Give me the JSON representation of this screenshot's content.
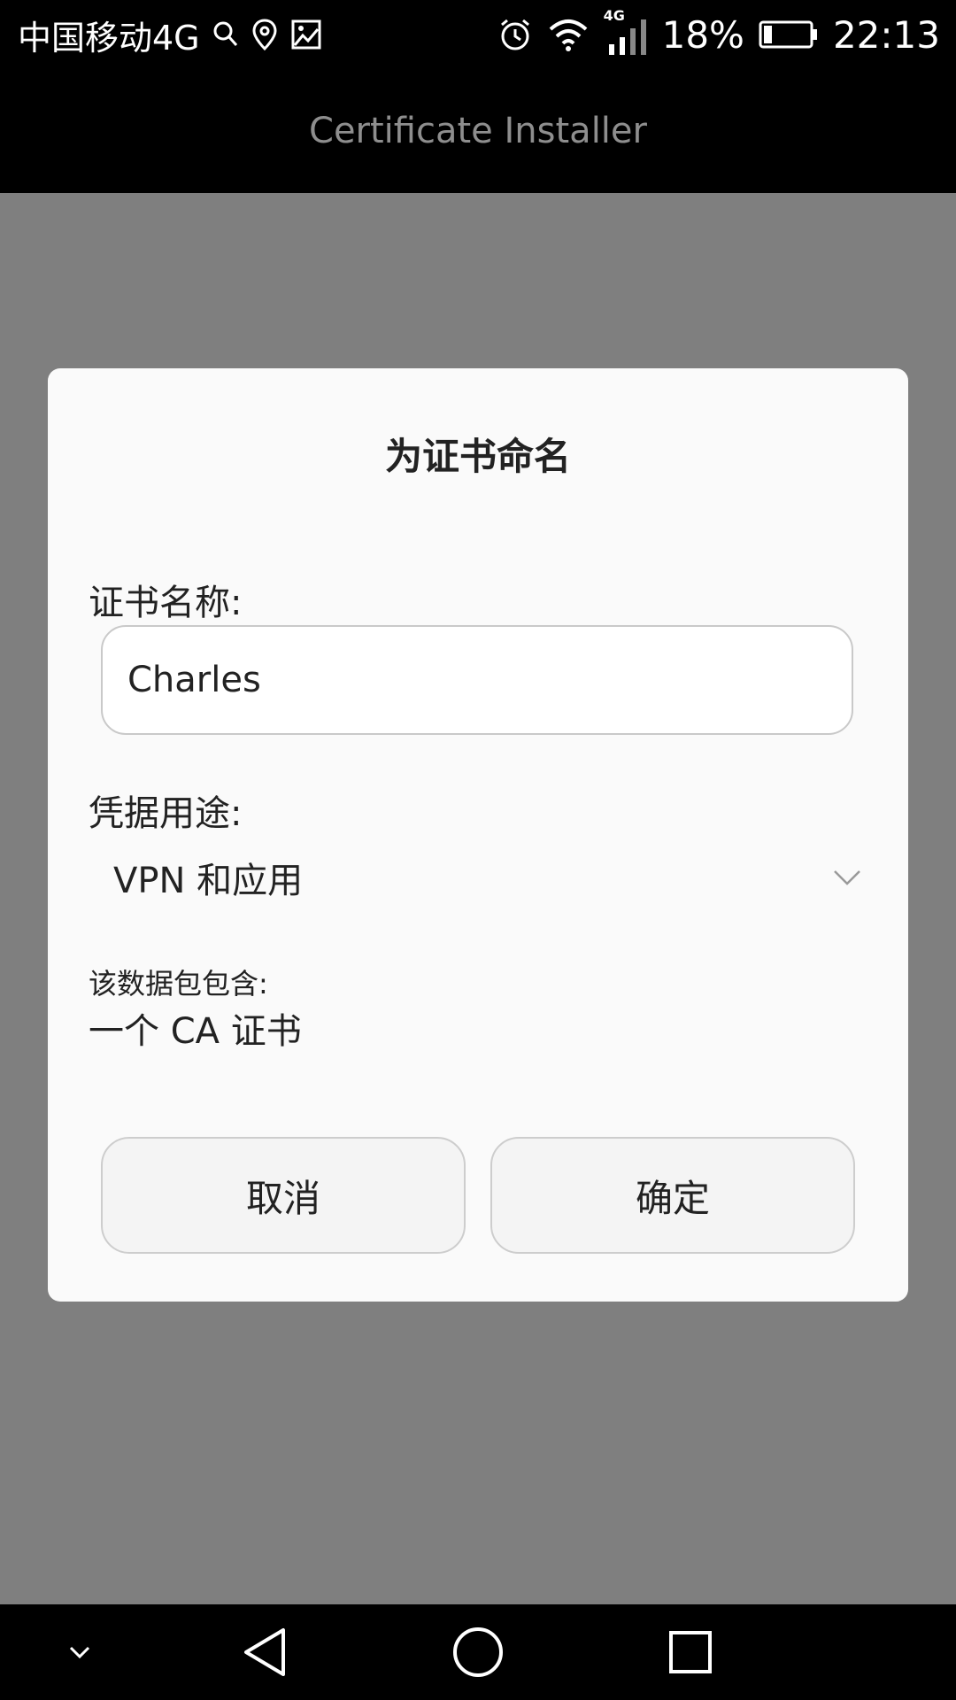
{
  "status_bar": {
    "carrier": "中国移动4G",
    "network_badge": "4G",
    "battery_percent": "18%",
    "time": "22:13",
    "icons": [
      "search-icon",
      "location-icon",
      "image-icon",
      "alarm-icon",
      "wifi-icon",
      "signal-icon",
      "battery-icon"
    ]
  },
  "app_bar": {
    "title": "Certificate Installer"
  },
  "dialog": {
    "title": "为证书命名",
    "name_label": "证书名称:",
    "name_value": "Charles",
    "usage_label": "凭据用途:",
    "usage_value": "VPN 和应用",
    "contains_label": "该数据包包含:",
    "contains_value": "一个 CA 证书",
    "cancel_label": "取消",
    "ok_label": "确定"
  },
  "nav_bar": {
    "icons": [
      "collapse-chevron-icon",
      "back-icon",
      "home-icon",
      "recents-icon"
    ]
  }
}
